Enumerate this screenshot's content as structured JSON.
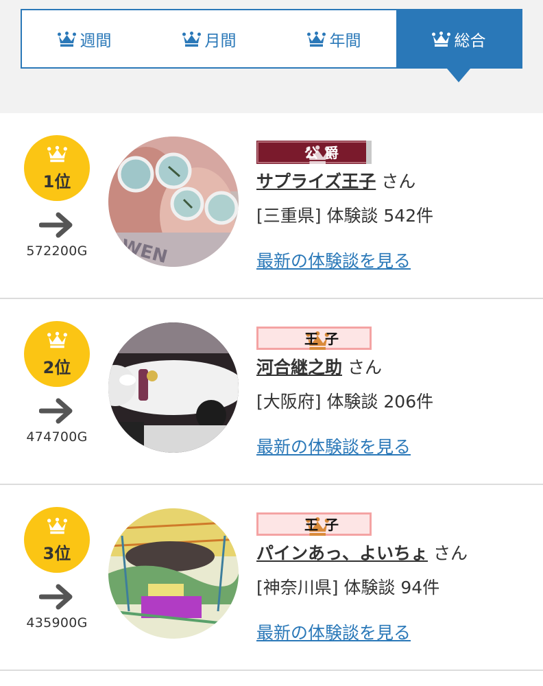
{
  "tabs": [
    {
      "label": "週間",
      "icon": "crown-icon"
    },
    {
      "label": "月間",
      "icon": "crown-icon"
    },
    {
      "label": "年間",
      "icon": "crown-icon"
    },
    {
      "label": "総合",
      "icon": "crown-icon",
      "active": true
    }
  ],
  "colors": {
    "accent": "#2a78b8",
    "badge": "#fbc514",
    "title_duke": "#7a1a2c",
    "title_prince": "#f4a3a3"
  },
  "ranking": [
    {
      "rank_label": "1位",
      "trend_icon": "arrow-right-icon",
      "points": "572200G",
      "title": "公爵",
      "username": "サプライズ王子",
      "honorific": "さん",
      "stats": "[三重県] 体験談 542件",
      "link": "最新の体験談を見る"
    },
    {
      "rank_label": "2位",
      "trend_icon": "arrow-right-icon",
      "points": "474700G",
      "title": "王子",
      "username": "河合継之助",
      "honorific": "さん",
      "stats": "[大阪府] 体験談 206件",
      "link": "最新の体験談を見る"
    },
    {
      "rank_label": "3位",
      "trend_icon": "arrow-right-icon",
      "points": "435900G",
      "title": "王子",
      "username": "パインあっ、よいちょ",
      "honorific": "さん",
      "stats": "[神奈川県] 体験談 94件",
      "link": "最新の体験談を見る"
    }
  ]
}
